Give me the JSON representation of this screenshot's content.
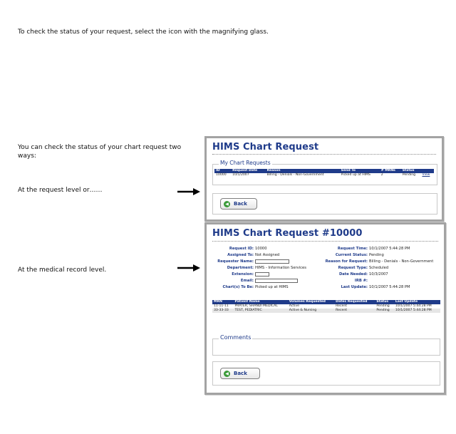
{
  "instructions": {
    "intro": "To check the status of your request, select the icon with the magnifying glass.",
    "two_ways": "You can check the status of your chart request two ways:",
    "request_level": "At the request level or……",
    "record_level": "At the medical record level."
  },
  "panel1": {
    "title": "HIMS Chart Request",
    "section_legend": "My Chart Requests",
    "columns": [
      "ID",
      "Request Date",
      "Reason",
      "Send To",
      "# MRNs",
      "Status",
      ""
    ],
    "rows": [
      [
        "10000",
        "10/1/2007",
        "Billing - Denials - Non-Government",
        "Picked up at HIMS",
        "2",
        "Pending",
        "View"
      ]
    ],
    "back_label": "Back"
  },
  "panel2": {
    "title": "HIMS Chart Request #10000",
    "left_fields": [
      {
        "label": "Request ID:",
        "value": "10000"
      },
      {
        "label": "Assigned To:",
        "value": "Not Assigned"
      },
      {
        "label": "Requester Name:",
        "value": ""
      },
      {
        "label": "Department:",
        "value": "HIMS - Information Services"
      },
      {
        "label": "Extension:",
        "value": ""
      },
      {
        "label": "Email:",
        "value": ""
      },
      {
        "label": "Chart(s) To Be:",
        "value": "Picked up at HIMS"
      }
    ],
    "right_fields": [
      {
        "label": "Request Time:",
        "value": "10/1/2007 5:44:28 PM"
      },
      {
        "label": "Current Status:",
        "value": "Pending"
      },
      {
        "label": "Reason for Request:",
        "value": "Billing - Denials - Non-Government"
      },
      {
        "label": "Request Type:",
        "value": "Scheduled"
      },
      {
        "label": "Date Needed:",
        "value": "10/3/2007"
      },
      {
        "label": "IRB #:",
        "value": ""
      },
      {
        "label": "Last Update:",
        "value": "10/1/2007 5:44:28 PM"
      }
    ],
    "columns": [
      "MRN",
      "Patient Name",
      "Volumes Requested",
      "Dates Requested",
      "Status",
      "Last Update"
    ],
    "rows": [
      [
        "11-11-11",
        "PRATER, SHANDI MEDICAL",
        "Active",
        "Recent",
        "Pending",
        "10/1/2007 5:44:28 PM"
      ],
      [
        "33-33-33",
        "TEST, PEDIATRIC",
        "Active & Nursing",
        "Recent",
        "Pending",
        "10/1/2007 5:44:28 PM"
      ]
    ],
    "comments_legend": "Comments",
    "back_label": "Back"
  },
  "colors": {
    "title_blue": "#1f3b8a",
    "header_bg": "#1f3b8a",
    "panel_border": "#a3a3a3",
    "back_icon_green": "#3a9a38"
  }
}
